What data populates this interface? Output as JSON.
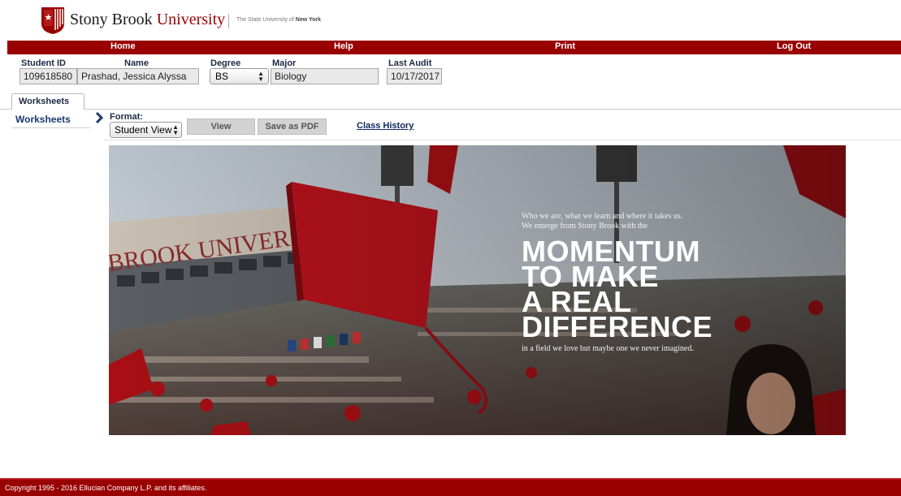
{
  "brand": {
    "name_part1": "Stony Brook",
    "name_part2": "University",
    "tagline_prefix": "The State University of",
    "tagline_bold": "New York",
    "color": "#990000"
  },
  "nav": {
    "items": [
      "Home",
      "Help",
      "Print",
      "Log Out"
    ]
  },
  "student": {
    "id_label": "Student ID",
    "id_value": "109618580",
    "name_label": "Name",
    "name_value": "Prashad, Jessica Alyssa",
    "degree_label": "Degree",
    "degree_value": "BS",
    "major_label": "Major",
    "major_value": "Biology",
    "audit_label": "Last Audit",
    "audit_value": "10/17/2017"
  },
  "tabs": {
    "worksheets": "Worksheets"
  },
  "sidebar": {
    "worksheets": "Worksheets"
  },
  "toolbar": {
    "format_label": "Format:",
    "format_value": "Student View",
    "view_label": "View",
    "pdf_label": "Save as PDF",
    "history_link": "Class History"
  },
  "banner": {
    "line1": "Who we are, what we learn and where it takes us.",
    "line2": "We emerge from Stony Brook with the",
    "big1": "MOMENTUM",
    "big2": "TO MAKE",
    "big3": "A REAL",
    "big4": "DIFFERENCE",
    "footer": "in a field we love but maybe one we never imagined.",
    "stadium_text": "BROOK UNIVERSIT"
  },
  "footer": {
    "copyright": "Copyright 1995 - 2016 Ellucian Company L.P. and its affiliates."
  }
}
